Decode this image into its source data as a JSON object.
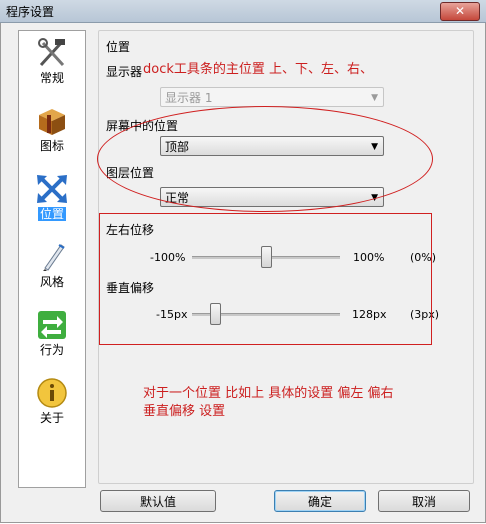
{
  "window": {
    "title": "程序设置",
    "close_glyph": "✕"
  },
  "sidebar": {
    "items": [
      {
        "label": "常规",
        "icon": "tools-icon"
      },
      {
        "label": "图标",
        "icon": "box-icon"
      },
      {
        "label": "位置",
        "icon": "arrows-icon",
        "active": true
      },
      {
        "label": "风格",
        "icon": "pen-icon"
      },
      {
        "label": "行为",
        "icon": "swap-icon"
      },
      {
        "label": "关于",
        "icon": "info-icon"
      }
    ]
  },
  "main": {
    "section_title": "位置",
    "monitor_label": "显示器",
    "monitor_select": "显示器 1",
    "screen_pos_label": "屏幕中的位置",
    "screen_pos_select": "顶部",
    "layer_label": "图层位置",
    "layer_select": "正常",
    "h_offset_label": "左右位移",
    "h_offset": {
      "min": "-100%",
      "max": "100%",
      "value": "(0%)",
      "fraction": 0.5
    },
    "v_offset_label": "垂直偏移",
    "v_offset": {
      "min": "-15px",
      "max": "128px",
      "value": "(3px)",
      "fraction": 0.13
    }
  },
  "buttons": {
    "defaults": "默认值",
    "ok": "确定",
    "cancel": "取消"
  },
  "annotations": {
    "top": "dock工具条的主位置 上、下、左、右、",
    "bottom_line1": "对于一个位置 比如上 具体的设置 偏左 偏右",
    "bottom_line2": "垂直偏移 设置"
  },
  "colors": {
    "annotation": "#cc1f1f",
    "active_nav": "#3399ff"
  }
}
